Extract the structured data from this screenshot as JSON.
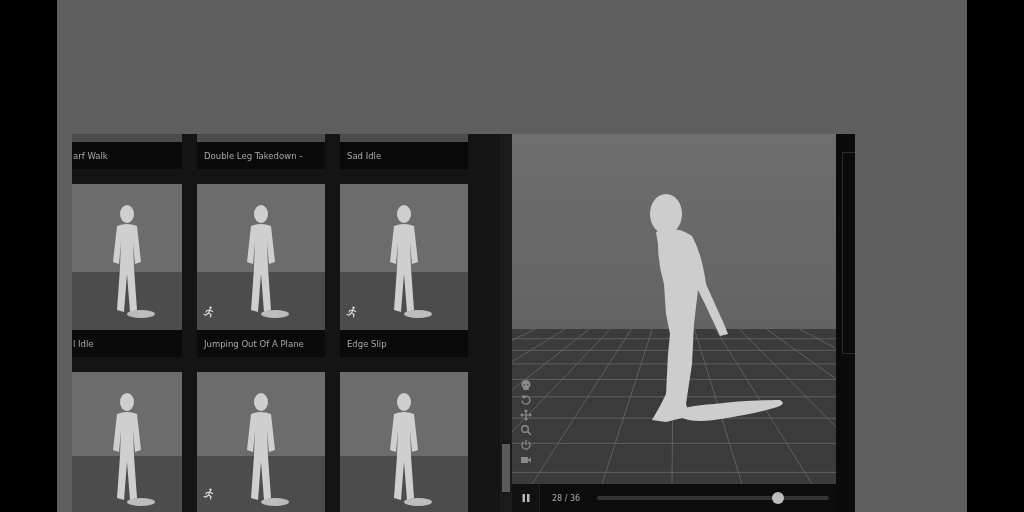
{
  "animations": [
    {
      "title": "arf Walk"
    },
    {
      "title": "Double Leg Takedown -"
    },
    {
      "title": "Sad Idle"
    },
    {
      "title": "l Idle",
      "run_icon": false
    },
    {
      "title": "Jumping Out Of A Plane",
      "run_icon": true
    },
    {
      "title": "Edge Slip",
      "run_icon": true
    },
    {
      "run_icon": false
    },
    {
      "run_icon": true
    },
    {
      "run_icon": false
    }
  ],
  "player": {
    "playing": true,
    "frame": "28 / 36",
    "level": 0.78
  }
}
